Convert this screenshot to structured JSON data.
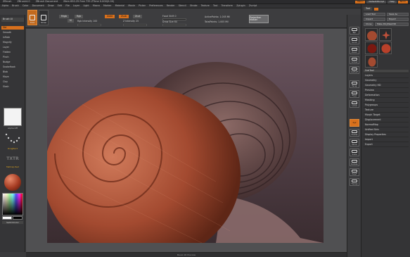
{
  "titlebar": {
    "segments": [
      "ZBrush",
      "ZBrush4.0",
      "ZBrush Document",
      "Mem 650.25  Free 735  ZTime 0.000(0.00)"
    ],
    "buttons": [
      "Menu",
      "DefaultZScript",
      "Help",
      "Nnnn"
    ]
  },
  "menubar": {
    "items": [
      "Alpha",
      "Brush",
      "Color",
      "Document",
      "Draw",
      "Edit",
      "File",
      "Layer",
      "Light",
      "Macro",
      "Marker",
      "Material",
      "Movie",
      "Picker",
      "Preferences",
      "Render",
      "Stencil",
      "Stroke",
      "Texture",
      "Tool",
      "Transform",
      "Zplugin",
      "Zscript"
    ]
  },
  "shelf": {
    "tools": [
      {
        "label": "Edit"
      },
      {
        "label": "Draw"
      }
    ],
    "labels": {
      "rgb": "Rgb",
      "m": "M",
      "mrgb": "Mrgb",
      "rgb_intensity": "Rgb Intensity 100",
      "zadd": "Zadd",
      "zsub": "Zsub",
      "zcut": "Zcut",
      "z_intensity": "Z Intensity 25",
      "focal_shift": "Focal Shift 0",
      "draw_size": "Draw Size 64",
      "active_points": "ActivePoints: 1.005 Mil",
      "total_points": "TotalPoints: 1.005 Mil",
      "projection_master": "Projection Master"
    }
  },
  "leftpanel": {
    "tab": "Brush UI",
    "items": [
      {
        "label": "Std",
        "selected": true
      },
      {
        "label": "Smooth",
        "selected": false
      },
      {
        "label": "Inflate",
        "selected": false
      },
      {
        "label": "Magnify",
        "selected": false
      },
      {
        "label": "Layer",
        "selected": false
      },
      {
        "label": "Flatten",
        "selected": false
      },
      {
        "label": "Pinch",
        "selected": false
      },
      {
        "label": "Nudge",
        "selected": false
      },
      {
        "label": "SnakeHook",
        "selected": false
      },
      {
        "label": "Blob",
        "selected": false
      },
      {
        "label": "Move",
        "selected": false
      },
      {
        "label": "Clay",
        "selected": false
      },
      {
        "label": "Slash",
        "selected": false
      }
    ],
    "alpha_label": "Alpha Off",
    "stroke_label": "DragRect",
    "texture_label": "TXTR",
    "material_label": "MatCap Red",
    "switch_color": "SwitchColor"
  },
  "rightcol": {
    "buttons": [
      "Bpr",
      "Scroll",
      "Zoom",
      "Actual",
      "AAHalf",
      "Persp",
      "Floor",
      "Local",
      "Xyz",
      "Frame",
      "Move",
      "Scale",
      "Rotate",
      "PolyF",
      "Transp"
    ]
  },
  "rightpanel": {
    "header": "Tool",
    "buttons": [
      "Load Tool",
      "Save As",
      "Import",
      "Export",
      "Clone",
      "Make PolyMesh3D"
    ],
    "menus": [
      "SubTool",
      "Layers",
      "Geometry",
      "Geometry HD",
      "Preview",
      "Deformation",
      "Masking",
      "Polygroups",
      "Texture",
      "Morph Target",
      "Displacement",
      "NormalMap",
      "Unified Skin",
      "Display Properties",
      "Import",
      "Export"
    ]
  },
  "canvas": {
    "description_hidden": ""
  },
  "bottombar": {
    "label": "Bevel AR Preview"
  }
}
